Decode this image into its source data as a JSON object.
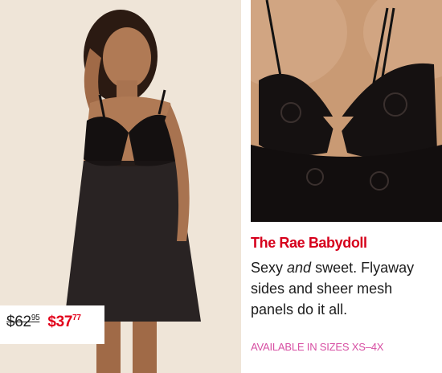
{
  "product": {
    "name": "The Rae Babydoll",
    "description_pre": "Sexy ",
    "description_em": "and",
    "description_post": " sweet. Flyaway sides and sheer mesh panels do it all.",
    "sizes": "AVAILABLE IN SIZES XS–4X"
  },
  "price": {
    "old_dollars": "$62",
    "old_cents": "95",
    "new_dollars": "$37",
    "new_cents": "77"
  },
  "colors": {
    "product_name": "#d6001c",
    "sale_price": "#e2001a",
    "sizes_text": "#d74fa3"
  }
}
